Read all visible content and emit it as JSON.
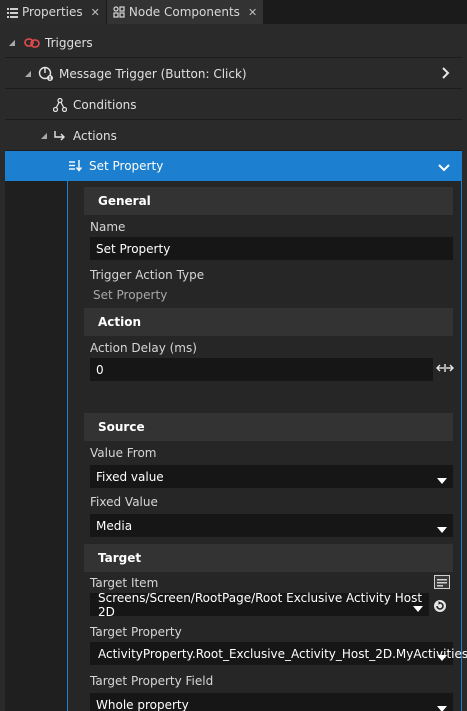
{
  "tabs": [
    {
      "label": "Properties",
      "icon": "properties-icon"
    },
    {
      "label": "Node Components",
      "icon": "node-components-icon"
    }
  ],
  "tree": {
    "triggers": {
      "label": "Triggers",
      "icon": "triggers-icon"
    },
    "message_trigger": {
      "label": "Message Trigger (Button: Click)",
      "icon": "message-trigger-icon"
    },
    "conditions": {
      "label": "Conditions",
      "icon": "conditions-icon"
    },
    "actions": {
      "label": "Actions",
      "icon": "actions-icon"
    },
    "set_property": {
      "label": "Set Property",
      "icon": "set-property-icon"
    }
  },
  "details": {
    "general": {
      "heading": "General",
      "name_label": "Name",
      "name_value": "Set Property",
      "type_label": "Trigger Action Type",
      "type_value": "Set Property"
    },
    "action": {
      "heading": "Action",
      "delay_label": "Action Delay (ms)",
      "delay_value": "0"
    },
    "source": {
      "heading": "Source",
      "value_from_label": "Value From",
      "value_from_value": "Fixed value",
      "fixed_value_label": "Fixed Value",
      "fixed_value_value": "Media"
    },
    "target": {
      "heading": "Target",
      "item_label": "Target Item",
      "item_value": "Screens/Screen/RootPage/Root Exclusive Activity Host 2D",
      "property_label": "Target Property",
      "property_value": "ActivityProperty.Root_Exclusive_Activity_Host_2D.MyActivities",
      "field_label": "Target Property Field",
      "field_value": "Whole property"
    }
  },
  "colors": {
    "selection": "#1c7fd0",
    "panel": "#2a2a2a",
    "field": "#161616",
    "trigger_icon": "#e84a4a"
  }
}
